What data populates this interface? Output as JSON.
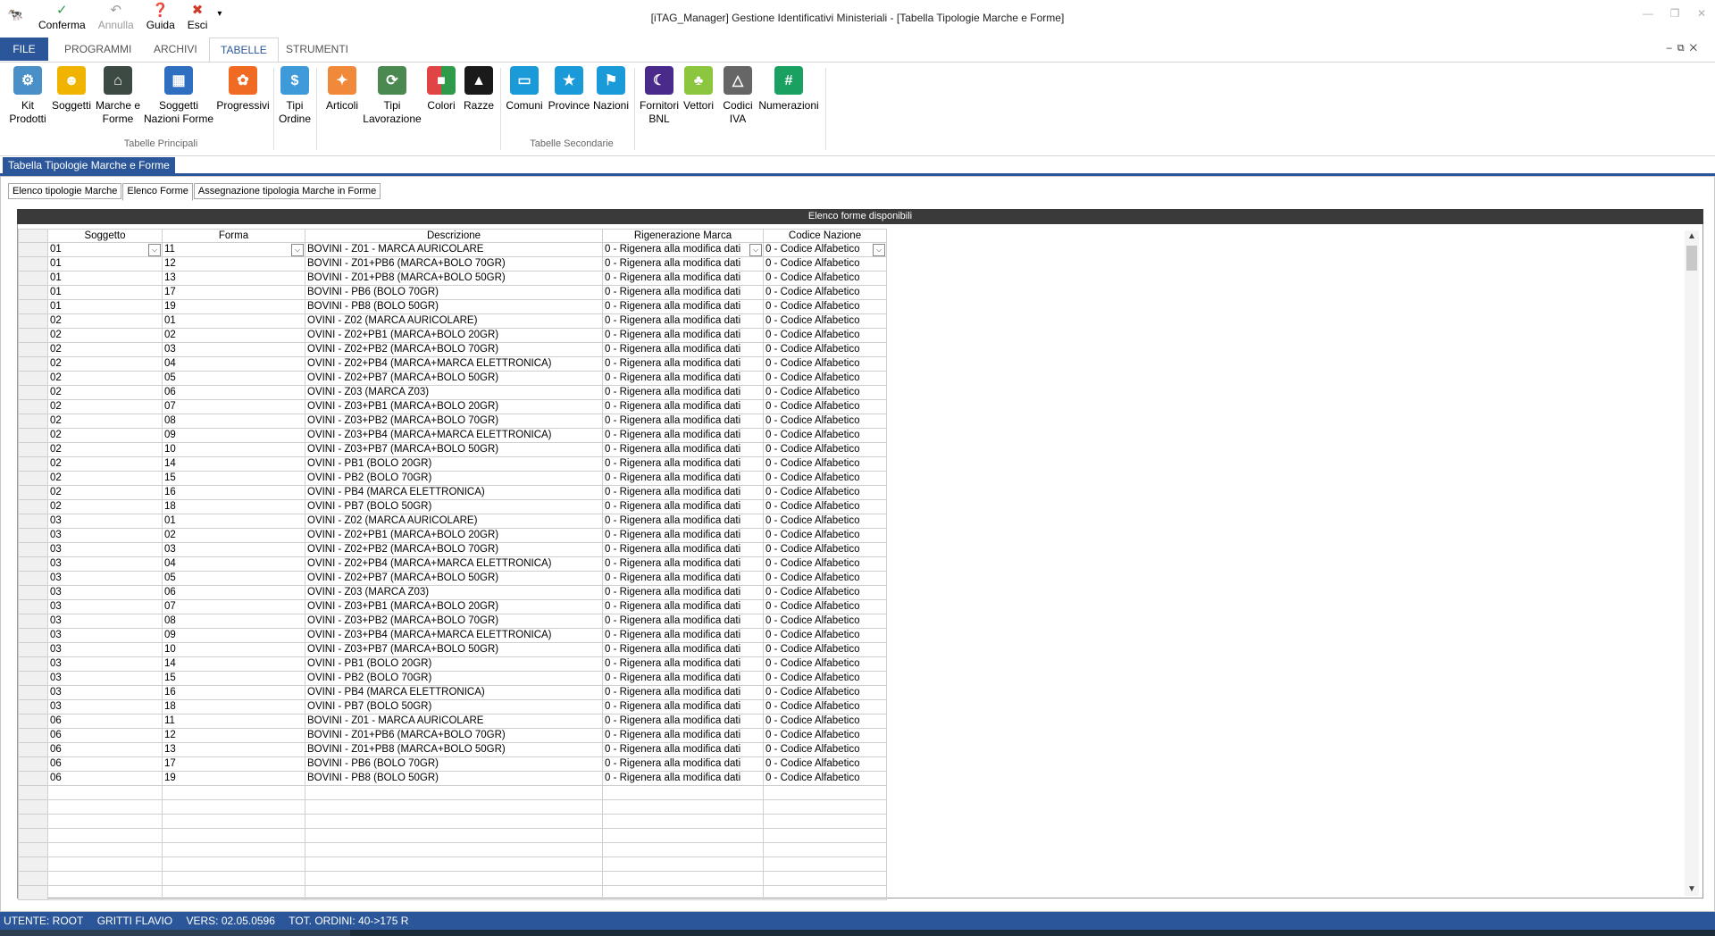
{
  "qat": {
    "buttons": [
      {
        "label": "Conferma",
        "icon": "check-icon"
      },
      {
        "label": "Annulla",
        "icon": "undo-icon"
      },
      {
        "label": "Guida",
        "icon": "help-icon"
      },
      {
        "label": "Esci",
        "icon": "exit-icon"
      }
    ],
    "more": "▾"
  },
  "window": {
    "title": "[iTAG_Manager] Gestione Identificativi Ministeriali - [Tabella Tipologie Marche e Forme]"
  },
  "ribbon_tabs": [
    "FILE",
    "PROGRAMMI",
    "ARCHIVI",
    "TABELLE",
    "STRUMENTI"
  ],
  "ribbon": {
    "groups": [
      "Tabelle Principali",
      "Tabelle Secondarie"
    ],
    "buttons": [
      {
        "label": "Kit\nProdotti",
        "color": "#4a90c8",
        "icon": "kit-icon"
      },
      {
        "label": "Soggetti",
        "color": "#f0b400",
        "icon": "user-icon"
      },
      {
        "label": "Marche e\nForme",
        "color": "#3d4a44",
        "icon": "tag-icon"
      },
      {
        "label": "Soggetti\nNazioni Forme",
        "color": "#2f6fc0",
        "icon": "grid-icon"
      },
      {
        "label": "Progressivi",
        "color": "#f06a21",
        "icon": "cycle-icon"
      },
      {
        "label": "Tipi\nOrdine",
        "color": "#3e9ad8",
        "icon": "order-icon"
      },
      {
        "label": "Articoli",
        "color": "#f08a3a",
        "icon": "box-icon"
      },
      {
        "label": "Tipi\nLavorazione",
        "color": "#4a8a50",
        "icon": "process-icon"
      },
      {
        "label": "Colori",
        "color": "#e04444",
        "icon": "palette-icon"
      },
      {
        "label": "Razze",
        "color": "#1a1a1a",
        "icon": "graduation-icon"
      },
      {
        "label": "Comuni",
        "color": "#1a9ad8",
        "icon": "folder-icon"
      },
      {
        "label": "Province",
        "color": "#1a9ad8",
        "icon": "folder-star-icon"
      },
      {
        "label": "Nazioni",
        "color": "#1a9ad8",
        "icon": "folder-flag-icon"
      },
      {
        "label": "Fornitori\nBNL",
        "color": "#4a2a8a",
        "icon": "moon-icon"
      },
      {
        "label": "Vettori",
        "color": "#8cc63e",
        "icon": "android-icon"
      },
      {
        "label": "Codici\nIVA",
        "color": "#666666",
        "icon": "triangle-icon"
      },
      {
        "label": "Numerazioni",
        "color": "#1aa060",
        "icon": "hash-icon"
      }
    ]
  },
  "doc": {
    "title": "Tabella Tipologie Marche e Forme",
    "subtabs": [
      "Elenco tipologie Marche",
      "Elenco Forme",
      "Assegnazione tipologia Marche in Forme"
    ]
  },
  "grid": {
    "caption": "Elenco forme disponibili",
    "columns": [
      "Soggetto",
      "Forma",
      "Descrizione",
      "Rigenerazione Marca",
      "Codice Nazione"
    ],
    "rows": [
      [
        "01",
        "11",
        "BOVINI - Z01 - MARCA AURICOLARE",
        "0 - Rigenera alla modifica dati",
        "0 - Codice Alfabetico"
      ],
      [
        "01",
        "12",
        "BOVINI - Z01+PB6 (MARCA+BOLO 70GR)",
        "0 - Rigenera alla modifica dati",
        "0 - Codice Alfabetico"
      ],
      [
        "01",
        "13",
        "BOVINI - Z01+PB8 (MARCA+BOLO 50GR)",
        "0 - Rigenera alla modifica dati",
        "0 - Codice Alfabetico"
      ],
      [
        "01",
        "17",
        "BOVINI - PB6 (BOLO 70GR)",
        "0 - Rigenera alla modifica dati",
        "0 - Codice Alfabetico"
      ],
      [
        "01",
        "19",
        "BOVINI - PB8 (BOLO 50GR)",
        "0 - Rigenera alla modifica dati",
        "0 - Codice Alfabetico"
      ],
      [
        "02",
        "01",
        "OVINI - Z02 (MARCA AURICOLARE)",
        "0 - Rigenera alla modifica dati",
        "0 - Codice Alfabetico"
      ],
      [
        "02",
        "02",
        "OVINI - Z02+PB1 (MARCA+BOLO 20GR)",
        "0 - Rigenera alla modifica dati",
        "0 - Codice Alfabetico"
      ],
      [
        "02",
        "03",
        "OVINI - Z02+PB2 (MARCA+BOLO 70GR)",
        "0 - Rigenera alla modifica dati",
        "0 - Codice Alfabetico"
      ],
      [
        "02",
        "04",
        "OVINI - Z02+PB4 (MARCA+MARCA ELETTRONICA)",
        "0 - Rigenera alla modifica dati",
        "0 - Codice Alfabetico"
      ],
      [
        "02",
        "05",
        "OVINI - Z02+PB7 (MARCA+BOLO 50GR)",
        "0 - Rigenera alla modifica dati",
        "0 - Codice Alfabetico"
      ],
      [
        "02",
        "06",
        "OVINI - Z03 (MARCA Z03)",
        "0 - Rigenera alla modifica dati",
        "0 - Codice Alfabetico"
      ],
      [
        "02",
        "07",
        "OVINI - Z03+PB1 (MARCA+BOLO 20GR)",
        "0 - Rigenera alla modifica dati",
        "0 - Codice Alfabetico"
      ],
      [
        "02",
        "08",
        "OVINI - Z03+PB2 (MARCA+BOLO 70GR)",
        "0 - Rigenera alla modifica dati",
        "0 - Codice Alfabetico"
      ],
      [
        "02",
        "09",
        "OVINI - Z03+PB4 (MARCA+MARCA ELETTRONICA)",
        "0 - Rigenera alla modifica dati",
        "0 - Codice Alfabetico"
      ],
      [
        "02",
        "10",
        "OVINI - Z03+PB7 (MARCA+BOLO 50GR)",
        "0 - Rigenera alla modifica dati",
        "0 - Codice Alfabetico"
      ],
      [
        "02",
        "14",
        "OVINI - PB1 (BOLO 20GR)",
        "0 - Rigenera alla modifica dati",
        "0 - Codice Alfabetico"
      ],
      [
        "02",
        "15",
        "OVINI - PB2 (BOLO 70GR)",
        "0 - Rigenera alla modifica dati",
        "0 - Codice Alfabetico"
      ],
      [
        "02",
        "16",
        "OVINI - PB4 (MARCA ELETTRONICA)",
        "0 - Rigenera alla modifica dati",
        "0 - Codice Alfabetico"
      ],
      [
        "02",
        "18",
        "OVINI - PB7 (BOLO 50GR)",
        "0 - Rigenera alla modifica dati",
        "0 - Codice Alfabetico"
      ],
      [
        "03",
        "01",
        "OVINI - Z02 (MARCA AURICOLARE)",
        "0 - Rigenera alla modifica dati",
        "0 - Codice Alfabetico"
      ],
      [
        "03",
        "02",
        "OVINI - Z02+PB1 (MARCA+BOLO 20GR)",
        "0 - Rigenera alla modifica dati",
        "0 - Codice Alfabetico"
      ],
      [
        "03",
        "03",
        "OVINI - Z02+PB2 (MARCA+BOLO 70GR)",
        "0 - Rigenera alla modifica dati",
        "0 - Codice Alfabetico"
      ],
      [
        "03",
        "04",
        "OVINI - Z02+PB4 (MARCA+MARCA ELETTRONICA)",
        "0 - Rigenera alla modifica dati",
        "0 - Codice Alfabetico"
      ],
      [
        "03",
        "05",
        "OVINI - Z02+PB7 (MARCA+BOLO 50GR)",
        "0 - Rigenera alla modifica dati",
        "0 - Codice Alfabetico"
      ],
      [
        "03",
        "06",
        "OVINI - Z03 (MARCA Z03)",
        "0 - Rigenera alla modifica dati",
        "0 - Codice Alfabetico"
      ],
      [
        "03",
        "07",
        "OVINI - Z03+PB1 (MARCA+BOLO 20GR)",
        "0 - Rigenera alla modifica dati",
        "0 - Codice Alfabetico"
      ],
      [
        "03",
        "08",
        "OVINI - Z03+PB2 (MARCA+BOLO 70GR)",
        "0 - Rigenera alla modifica dati",
        "0 - Codice Alfabetico"
      ],
      [
        "03",
        "09",
        "OVINI - Z03+PB4 (MARCA+MARCA ELETTRONICA)",
        "0 - Rigenera alla modifica dati",
        "0 - Codice Alfabetico"
      ],
      [
        "03",
        "10",
        "OVINI - Z03+PB7 (MARCA+BOLO 50GR)",
        "0 - Rigenera alla modifica dati",
        "0 - Codice Alfabetico"
      ],
      [
        "03",
        "14",
        "OVINI - PB1 (BOLO 20GR)",
        "0 - Rigenera alla modifica dati",
        "0 - Codice Alfabetico"
      ],
      [
        "03",
        "15",
        "OVINI - PB2 (BOLO 70GR)",
        "0 - Rigenera alla modifica dati",
        "0 - Codice Alfabetico"
      ],
      [
        "03",
        "16",
        "OVINI - PB4 (MARCA ELETTRONICA)",
        "0 - Rigenera alla modifica dati",
        "0 - Codice Alfabetico"
      ],
      [
        "03",
        "18",
        "OVINI - PB7 (BOLO 50GR)",
        "0 - Rigenera alla modifica dati",
        "0 - Codice Alfabetico"
      ],
      [
        "06",
        "11",
        "BOVINI - Z01 - MARCA AURICOLARE",
        "0 - Rigenera alla modifica dati",
        "0 - Codice Alfabetico"
      ],
      [
        "06",
        "12",
        "BOVINI - Z01+PB6 (MARCA+BOLO 70GR)",
        "0 - Rigenera alla modifica dati",
        "0 - Codice Alfabetico"
      ],
      [
        "06",
        "13",
        "BOVINI - Z01+PB8 (MARCA+BOLO 50GR)",
        "0 - Rigenera alla modifica dati",
        "0 - Codice Alfabetico"
      ],
      [
        "06",
        "17",
        "BOVINI - PB6 (BOLO 70GR)",
        "0 - Rigenera alla modifica dati",
        "0 - Codice Alfabetico"
      ],
      [
        "06",
        "19",
        "BOVINI - PB8 (BOLO 50GR)",
        "0 - Rigenera alla modifica dati",
        "0 - Codice Alfabetico"
      ]
    ]
  },
  "status": {
    "utente": "UTENTE: ROOT",
    "nome": "GRITTI FLAVIO",
    "versione": "VERS: 02.05.0596",
    "ordini": "TOT. ORDINI: 40->175 R"
  },
  "colors": {
    "accent": "#2b579a",
    "caption": "#3a3a3a"
  }
}
